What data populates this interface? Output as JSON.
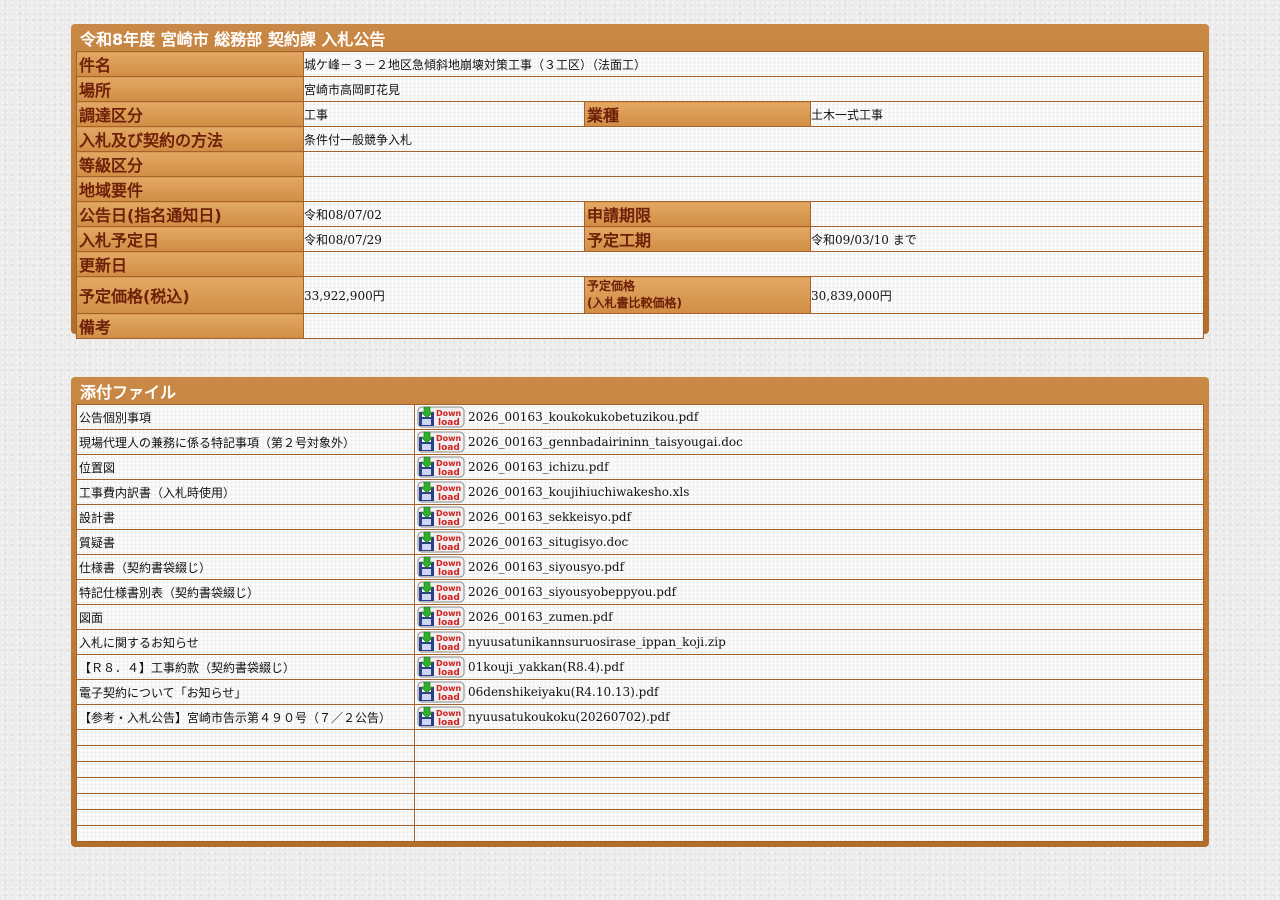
{
  "notice": {
    "title": "令和8年度  宮崎市  総務部  契約課  入札公告",
    "rows": {
      "subject": {
        "label": "件名",
        "value": "城ケ峰－３－２地区急傾斜地崩壊対策工事（３工区）（法面工）"
      },
      "location": {
        "label": "場所",
        "value": "宮崎市高岡町花見"
      },
      "procurement": {
        "label": "調達区分",
        "value": "工事",
        "label2": "業種",
        "value2": "土木一式工事"
      },
      "method": {
        "label": "入札及び契約の方法",
        "value": "条件付一般競争入札"
      },
      "grade": {
        "label": "等級区分",
        "value": ""
      },
      "region": {
        "label": "地域要件",
        "value": ""
      },
      "announce": {
        "label": "公告日(指名通知日)",
        "value": "令和08/07/02",
        "label2": "申請期限",
        "value2": ""
      },
      "bid_date": {
        "label": "入札予定日",
        "value": "令和08/07/29",
        "label2": "予定工期",
        "value2": "令和09/03/10 まで"
      },
      "updated": {
        "label": "更新日",
        "value": ""
      },
      "price": {
        "label": "予定価格(税込)",
        "value": "33,922,900円",
        "label2a": "予定価格",
        "label2b": "(入札書比較価格)",
        "value2": "30,839,000円"
      },
      "remarks": {
        "label": "備考",
        "value": ""
      }
    }
  },
  "attachments": {
    "title": "添付ファイル",
    "icon_name": "download-icon",
    "items": [
      {
        "name": "公告個別事項",
        "file": "2026_00163_koukokukobetuzikou.pdf"
      },
      {
        "name": "現場代理人の兼務に係る特記事項（第２号対象外）",
        "file": "2026_00163_gennbadairininn_taisyougai.doc"
      },
      {
        "name": "位置図",
        "file": "2026_00163_ichizu.pdf"
      },
      {
        "name": "工事費内訳書（入札時使用）",
        "file": "2026_00163_koujihiuchiwakesho.xls"
      },
      {
        "name": "設計書",
        "file": "2026_00163_sekkeisyo.pdf"
      },
      {
        "name": "質疑書",
        "file": "2026_00163_situgisyo.doc"
      },
      {
        "name": "仕様書（契約書袋綴じ）",
        "file": "2026_00163_siyousyo.pdf"
      },
      {
        "name": "特記仕様書別表（契約書袋綴じ）",
        "file": "2026_00163_siyousyobeppyou.pdf"
      },
      {
        "name": "図面",
        "file": "2026_00163_zumen.pdf"
      },
      {
        "name": "入札に関するお知らせ",
        "file": "nyuusatunikannsuruosirase_ippan_koji.zip"
      },
      {
        "name": "【Ｒ８．４】工事約款（契約書袋綴じ）",
        "file": "01kouji_yakkan(R8.4).pdf"
      },
      {
        "name": "電子契約について「お知らせ」",
        "file": "06denshikeiyaku(R4.10.13).pdf"
      },
      {
        "name": "【参考・入札公告】宮崎市告示第４９０号（７／２公告）",
        "file": "nyuusatukoukoku(20260702).pdf"
      }
    ],
    "empty_rows": 7
  }
}
